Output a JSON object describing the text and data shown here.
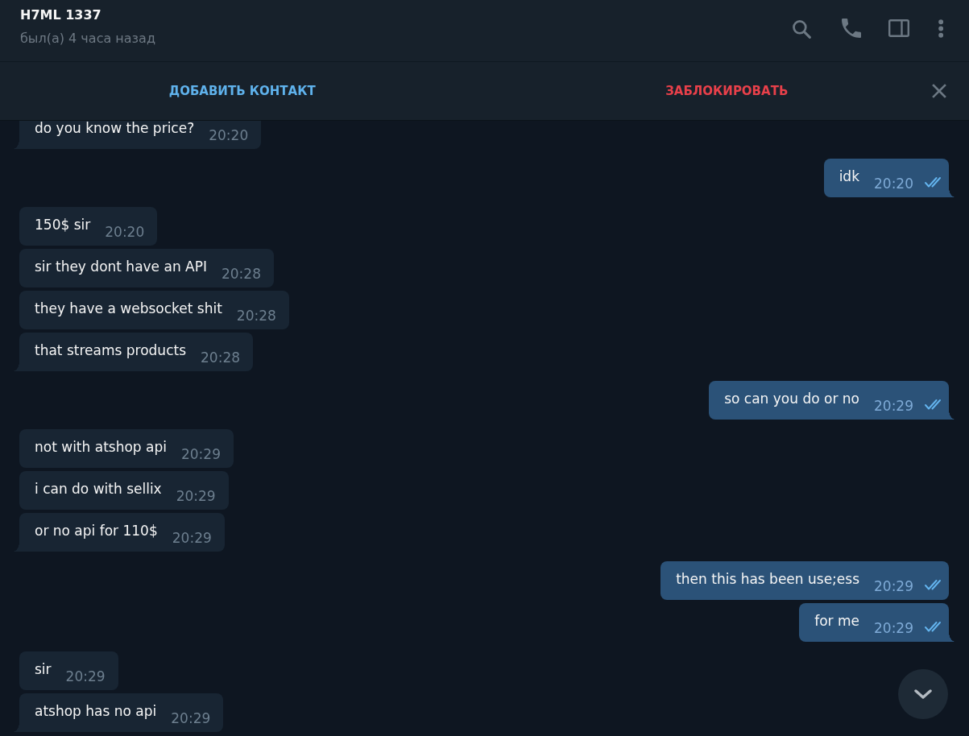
{
  "header": {
    "title": "H7ML 1337",
    "status": "был(а) 4 часа назад"
  },
  "action_bar": {
    "add_contact": "ДОБАВИТЬ КОНТАКТ",
    "block": "ЗАБЛОКИРОВАТЬ"
  },
  "message_groups": [
    {
      "kind": "incoming",
      "messages": [
        {
          "text": "do you know the price?",
          "time": "20:20"
        }
      ]
    },
    {
      "kind": "outgoing",
      "messages": [
        {
          "text": "idk",
          "time": "20:20",
          "read": true
        }
      ]
    },
    {
      "kind": "incoming",
      "messages": [
        {
          "text": "150$ sir",
          "time": "20:20"
        },
        {
          "text": "sir they dont have an API",
          "time": "20:28"
        },
        {
          "text": "they have a websocket shit",
          "time": "20:28"
        },
        {
          "text": "that streams products",
          "time": "20:28"
        }
      ]
    },
    {
      "kind": "outgoing",
      "messages": [
        {
          "text": "so can you do or no",
          "time": "20:29",
          "read": true
        }
      ]
    },
    {
      "kind": "incoming",
      "messages": [
        {
          "text": "not with atshop api",
          "time": "20:29"
        },
        {
          "text": "i can do with sellix",
          "time": "20:29"
        },
        {
          "text": "or no api for 110$",
          "time": "20:29"
        }
      ]
    },
    {
      "kind": "outgoing",
      "messages": [
        {
          "text": "then this has been use;ess",
          "time": "20:29",
          "read": true
        },
        {
          "text": "for me",
          "time": "20:29",
          "read": true
        }
      ]
    },
    {
      "kind": "incoming",
      "messages": [
        {
          "text": "sir",
          "time": "20:29"
        },
        {
          "text": "atshop has no api",
          "time": "20:29"
        }
      ]
    }
  ]
}
